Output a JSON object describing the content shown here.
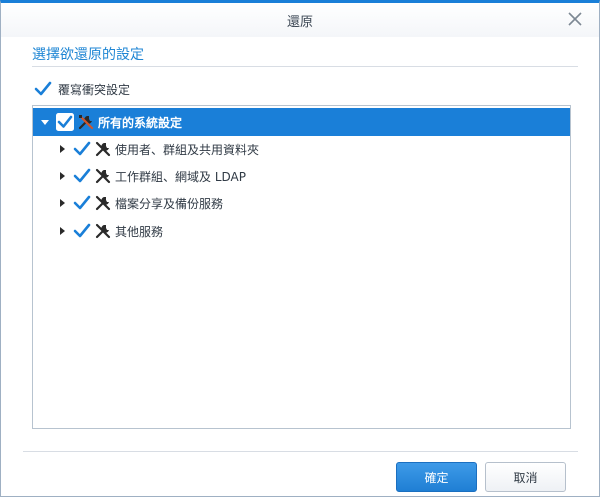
{
  "dialog": {
    "title": "還原",
    "section_title": "選擇欲還原的設定"
  },
  "overwrite_option": {
    "label": "覆寫衝突設定",
    "checked": true
  },
  "tree": {
    "root": {
      "label": "所有的系統設定",
      "checked": true,
      "expanded": true,
      "selected": true
    },
    "children": [
      {
        "label": "使用者、群組及共用資料夾",
        "checked": true,
        "expanded": false
      },
      {
        "label": "工作群組、網域及 LDAP",
        "checked": true,
        "expanded": false
      },
      {
        "label": "檔案分享及備份服務",
        "checked": true,
        "expanded": false
      },
      {
        "label": "其他服務",
        "checked": true,
        "expanded": false
      }
    ]
  },
  "buttons": {
    "ok": "確定",
    "cancel": "取消"
  },
  "icons": {
    "close": "close-icon",
    "checkbox": "checkmark-icon",
    "settings": "tools-icon",
    "expanded": "triangle-down-icon",
    "collapsed": "triangle-right-icon"
  },
  "colors": {
    "accent": "#1a7fd8",
    "selected_row": "#1a7fd8",
    "check": "#1a7fd8"
  }
}
